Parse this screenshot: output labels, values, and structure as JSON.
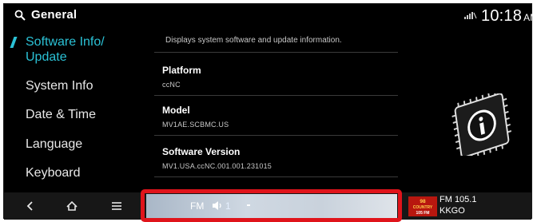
{
  "header": {
    "title": "General",
    "time": "10:18",
    "ampm": "AM"
  },
  "sidebar": {
    "items": [
      {
        "label": "Software Info/\nUpdate",
        "active": true
      },
      {
        "label": "System Info",
        "active": false
      },
      {
        "label": "Date & Time",
        "active": false
      },
      {
        "label": "Language",
        "active": false
      },
      {
        "label": "Keyboard",
        "active": false
      }
    ]
  },
  "content": {
    "description": "Displays system software and update information.",
    "sections": [
      {
        "title": "Platform",
        "value": "ccNC"
      },
      {
        "title": "Model",
        "value": "MV1AE.SCBMC.US"
      },
      {
        "title": "Software Version",
        "value": "MV1.USA.ccNC.001.001.231015"
      }
    ]
  },
  "bottom_bar": {
    "media": {
      "band": "FM",
      "preset": "1"
    },
    "station": {
      "logo_text": "98 COUNTRY 105 FM",
      "frequency": "FM 105.1",
      "callsign": "KKGO"
    }
  },
  "colors": {
    "accent": "#2bc2d6",
    "highlight": "#e0141b",
    "background": "#000000"
  },
  "icons": [
    "search-icon",
    "signal-status-icon",
    "chip-info-icon",
    "back-icon",
    "home-icon",
    "menu-icon",
    "volume-icon"
  ]
}
